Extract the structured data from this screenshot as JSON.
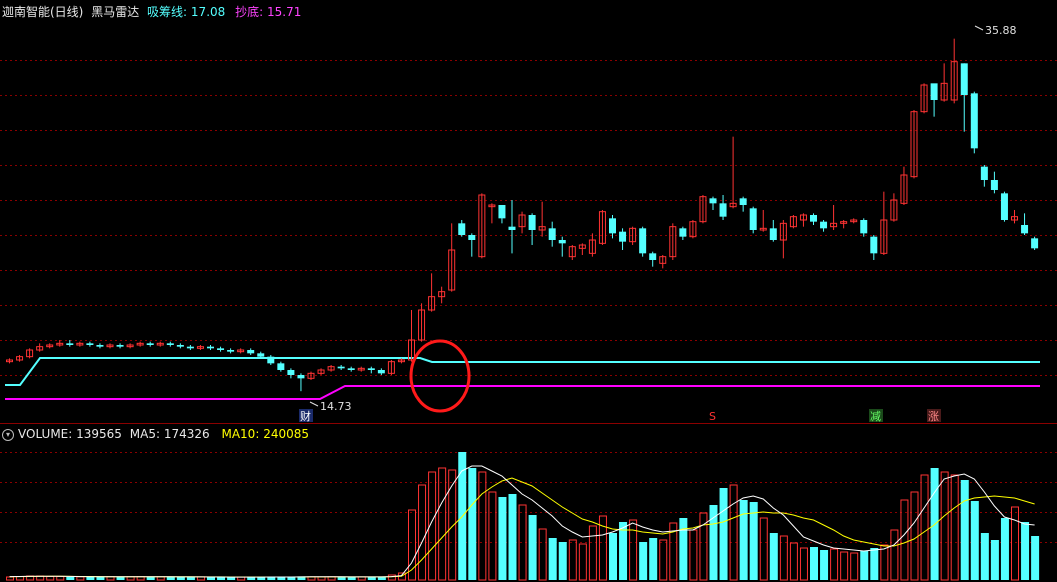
{
  "header": {
    "stock_name": "迦南智能(日线)",
    "indicator_name": "黑马雷达",
    "absorb_label": "吸筹线:",
    "absorb_value": "17.08",
    "bottom_label": "抄底:",
    "bottom_value": "15.71"
  },
  "volume_header": {
    "volume_label": "VOLUME:",
    "volume_value": "139565",
    "ma5_label": "MA5:",
    "ma5_value": "174326",
    "ma10_label": "MA10:",
    "ma10_value": "240085"
  },
  "annotations": {
    "high_label": "35.88",
    "low_label": "14.73",
    "cai_marker": "财",
    "s_marker": "S",
    "jian_marker": "减",
    "zhang_marker": "涨"
  },
  "colors": {
    "background": "#000000",
    "up_candle": "#ff3333",
    "down_candle": "#54ffff",
    "absorb_line": "#54ffff",
    "bottom_line": "#ff00ff",
    "ma5_line": "#ffffff",
    "ma10_line": "#ffff00",
    "grid": "#8b0000",
    "highlight_circle": "#ff0000"
  },
  "chart_data": {
    "type": "candlestick",
    "price_range": [
      13.0,
      37.0
    ],
    "absorb_line_value": 17.08,
    "bottom_line_value": 15.71,
    "candles": [
      [
        16.5,
        16.6,
        16.7,
        16.4
      ],
      [
        16.6,
        16.8,
        16.9,
        16.5
      ],
      [
        16.8,
        17.2,
        17.3,
        16.7
      ],
      [
        17.2,
        17.4,
        17.6,
        17.1
      ],
      [
        17.4,
        17.5,
        17.6,
        17.3
      ],
      [
        17.5,
        17.6,
        17.8,
        17.4
      ],
      [
        17.6,
        17.5,
        17.8,
        17.4
      ],
      [
        17.5,
        17.6,
        17.7,
        17.4
      ],
      [
        17.6,
        17.5,
        17.7,
        17.4
      ],
      [
        17.5,
        17.4,
        17.6,
        17.3
      ],
      [
        17.4,
        17.5,
        17.6,
        17.3
      ],
      [
        17.5,
        17.4,
        17.6,
        17.3
      ],
      [
        17.4,
        17.5,
        17.6,
        17.3
      ],
      [
        17.5,
        17.6,
        17.7,
        17.4
      ],
      [
        17.6,
        17.5,
        17.7,
        17.4
      ],
      [
        17.5,
        17.6,
        17.7,
        17.4
      ],
      [
        17.6,
        17.5,
        17.7,
        17.4
      ],
      [
        17.5,
        17.4,
        17.6,
        17.3
      ],
      [
        17.4,
        17.3,
        17.5,
        17.2
      ],
      [
        17.3,
        17.4,
        17.5,
        17.2
      ],
      [
        17.4,
        17.3,
        17.5,
        17.2
      ],
      [
        17.3,
        17.2,
        17.4,
        17.1
      ],
      [
        17.2,
        17.1,
        17.3,
        17.0
      ],
      [
        17.1,
        17.2,
        17.3,
        17.0
      ],
      [
        17.2,
        17.0,
        17.3,
        16.9
      ],
      [
        17.0,
        16.8,
        17.1,
        16.7
      ],
      [
        16.8,
        16.4,
        16.9,
        16.3
      ],
      [
        16.4,
        16.0,
        16.5,
        15.9
      ],
      [
        16.0,
        15.7,
        16.1,
        15.5
      ],
      [
        15.7,
        15.5,
        15.8,
        14.73
      ],
      [
        15.5,
        15.8,
        15.9,
        15.4
      ],
      [
        15.8,
        16.0,
        16.1,
        15.7
      ],
      [
        16.0,
        16.2,
        16.3,
        15.9
      ],
      [
        16.2,
        16.1,
        16.3,
        16.0
      ],
      [
        16.1,
        16.0,
        16.2,
        15.9
      ],
      [
        16.0,
        16.1,
        16.2,
        15.9
      ],
      [
        16.1,
        16.0,
        16.2,
        15.8
      ],
      [
        16.0,
        15.8,
        16.1,
        15.7
      ],
      [
        15.8,
        16.5,
        16.6,
        15.7
      ],
      [
        16.5,
        16.6,
        16.7,
        16.4
      ],
      [
        16.6,
        17.8,
        19.6,
        16.5
      ],
      [
        17.8,
        19.6,
        20.0,
        17.7
      ],
      [
        19.6,
        20.4,
        21.8,
        19.5
      ],
      [
        20.4,
        20.7,
        21.0,
        20.0
      ],
      [
        20.8,
        23.2,
        24.8,
        20.7
      ],
      [
        24.8,
        24.1,
        25.0,
        24.0
      ],
      [
        24.1,
        23.8,
        24.2,
        22.8
      ],
      [
        22.8,
        26.5,
        26.6,
        22.7
      ],
      [
        25.8,
        25.9,
        26.0,
        24.8
      ],
      [
        25.9,
        25.1,
        25.9,
        24.8
      ],
      [
        24.6,
        24.4,
        26.2,
        23.0
      ],
      [
        24.6,
        25.3,
        25.5,
        24.2
      ],
      [
        25.3,
        24.4,
        25.4,
        23.5
      ],
      [
        24.4,
        24.6,
        26.1,
        24.0
      ],
      [
        24.5,
        23.8,
        24.9,
        23.4
      ],
      [
        23.8,
        23.6,
        24.0,
        22.8
      ],
      [
        22.8,
        23.4,
        23.5,
        22.6
      ],
      [
        23.3,
        23.5,
        23.6,
        22.9
      ],
      [
        23.0,
        23.8,
        24.2,
        22.8
      ],
      [
        23.6,
        25.5,
        25.6,
        23.5
      ],
      [
        25.1,
        24.2,
        25.3,
        23.9
      ],
      [
        24.3,
        23.7,
        24.5,
        23.2
      ],
      [
        23.7,
        24.5,
        24.6,
        23.5
      ],
      [
        24.5,
        23.0,
        24.6,
        22.8
      ],
      [
        23.0,
        22.6,
        23.1,
        22.2
      ],
      [
        22.4,
        22.8,
        22.9,
        22.1
      ],
      [
        22.8,
        24.6,
        24.8,
        22.6
      ],
      [
        24.5,
        24.0,
        24.6,
        23.8
      ],
      [
        24.0,
        24.9,
        25.0,
        23.9
      ],
      [
        24.9,
        26.4,
        26.5,
        24.8
      ],
      [
        26.3,
        26.0,
        26.4,
        25.6
      ],
      [
        26.0,
        25.2,
        26.5,
        25.0
      ],
      [
        25.8,
        26.0,
        30.0,
        25.7
      ],
      [
        26.3,
        25.9,
        26.4,
        25.5
      ],
      [
        25.7,
        24.4,
        25.8,
        24.2
      ],
      [
        24.4,
        24.5,
        25.6,
        24.3
      ],
      [
        24.5,
        23.8,
        25.0,
        23.7
      ],
      [
        23.8,
        24.8,
        25.0,
        22.7
      ],
      [
        24.6,
        25.2,
        25.3,
        24.5
      ],
      [
        25.0,
        25.3,
        25.4,
        24.6
      ],
      [
        25.3,
        24.9,
        25.4,
        24.7
      ],
      [
        24.9,
        24.5,
        25.0,
        24.3
      ],
      [
        24.6,
        24.8,
        25.9,
        24.4
      ],
      [
        24.8,
        24.9,
        25.0,
        24.5
      ],
      [
        24.9,
        25.0,
        25.1,
        24.8
      ],
      [
        25.0,
        24.2,
        25.1,
        24.0
      ],
      [
        24.0,
        23.0,
        24.1,
        22.6
      ],
      [
        23.0,
        25.0,
        26.7,
        22.9
      ],
      [
        25.0,
        26.2,
        26.6,
        24.9
      ],
      [
        26.0,
        27.7,
        28.2,
        25.9
      ],
      [
        27.6,
        31.5,
        31.6,
        27.5
      ],
      [
        31.5,
        33.1,
        33.2,
        31.4
      ],
      [
        33.2,
        32.2,
        32.3,
        31.2
      ],
      [
        32.2,
        33.2,
        34.4,
        32.1
      ],
      [
        32.2,
        34.5,
        35.88,
        32.0
      ],
      [
        34.4,
        32.5,
        34.4,
        30.3
      ],
      [
        32.6,
        29.3,
        32.7,
        29.0
      ],
      [
        28.2,
        27.4,
        28.3,
        27.0
      ],
      [
        27.4,
        26.8,
        27.9,
        26.6
      ],
      [
        26.6,
        25.0,
        26.7,
        24.9
      ],
      [
        25.0,
        25.2,
        25.6,
        24.8
      ],
      [
        24.7,
        24.2,
        25.4,
        24.1
      ],
      [
        23.9,
        23.3,
        24.0,
        23.2
      ]
    ],
    "volume_max": 140000,
    "volume": [
      3000,
      3500,
      4000,
      4000,
      3500,
      3500,
      3000,
      3200,
      3400,
      3000,
      3300,
      3100,
      3200,
      3300,
      3000,
      3100,
      3200,
      3000,
      2900,
      3100,
      2800,
      2900,
      3000,
      2900,
      2800,
      3000,
      3200,
      3000,
      3100,
      3600,
      3100,
      3000,
      3200,
      3000,
      2900,
      3100,
      3000,
      3200,
      5000,
      7000,
      70000,
      95000,
      108000,
      112000,
      110000,
      128000,
      112000,
      108000,
      88000,
      83000,
      86000,
      75000,
      65000,
      51000,
      42000,
      38000,
      40000,
      36000,
      54000,
      64000,
      47000,
      58000,
      60000,
      38000,
      42000,
      40000,
      57000,
      62000,
      50000,
      67000,
      75000,
      92000,
      95000,
      80000,
      78000,
      62000,
      47000,
      44000,
      37000,
      32000,
      33000,
      30000,
      31000,
      28000,
      27000,
      29000,
      32000,
      35000,
      50000,
      80000,
      88000,
      105000,
      112000,
      108000,
      105000,
      100000,
      79000,
      47000,
      40000,
      62000,
      73000,
      58000,
      44000
    ],
    "ma5": [
      3400,
      3500,
      3700,
      3800,
      3800,
      3700,
      3600,
      3400,
      3300,
      3200,
      3200,
      3200,
      3200,
      3200,
      3200,
      3200,
      3200,
      3100,
      3100,
      3100,
      3000,
      3000,
      2900,
      2900,
      2900,
      2900,
      3000,
      3000,
      3000,
      3100,
      3200,
      3200,
      3200,
      3200,
      3100,
      3100,
      3100,
      3100,
      3400,
      4400,
      17000,
      37000,
      58000,
      77000,
      94000,
      109000,
      114000,
      114000,
      109000,
      104000,
      95000,
      86000,
      80000,
      72000,
      64000,
      54000,
      48000,
      43000,
      44000,
      45000,
      48000,
      52000,
      57000,
      53000,
      50000,
      48000,
      49000,
      50000,
      50000,
      55000,
      62000,
      69000,
      76000,
      82000,
      84000,
      81000,
      72000,
      65000,
      54000,
      43000,
      39000,
      35000,
      32000,
      31000,
      30000,
      29000,
      30000,
      31000,
      35000,
      45000,
      57000,
      72000,
      87000,
      101000,
      104000,
      106000,
      101000,
      88000,
      74000,
      63000,
      60000,
      56000,
      55000
    ],
    "ma10": [
      3300,
      3400,
      3500,
      3600,
      3700,
      3700,
      3600,
      3500,
      3500,
      3400,
      3300,
      3300,
      3300,
      3200,
      3200,
      3200,
      3200,
      3200,
      3200,
      3100,
      3100,
      3100,
      3000,
      3000,
      3000,
      3000,
      3000,
      3000,
      3000,
      3000,
      3100,
      3100,
      3100,
      3100,
      3100,
      3100,
      3100,
      3100,
      3300,
      3700,
      10000,
      20000,
      31000,
      42000,
      53000,
      63000,
      75000,
      86000,
      93000,
      99000,
      102000,
      98000,
      94000,
      87000,
      80000,
      73000,
      67000,
      61000,
      58000,
      54000,
      51000,
      50000,
      50000,
      48000,
      47000,
      46000,
      48000,
      51000,
      52000,
      55000,
      56000,
      58000,
      62000,
      66000,
      67000,
      68000,
      67000,
      67000,
      65000,
      62000,
      60000,
      55000,
      50000,
      44000,
      40000,
      38000,
      36000,
      34000,
      34000,
      37000,
      41000,
      48000,
      55000,
      64000,
      72000,
      79000,
      82000,
      83000,
      84000,
      83000,
      82000,
      79000,
      76000
    ]
  }
}
